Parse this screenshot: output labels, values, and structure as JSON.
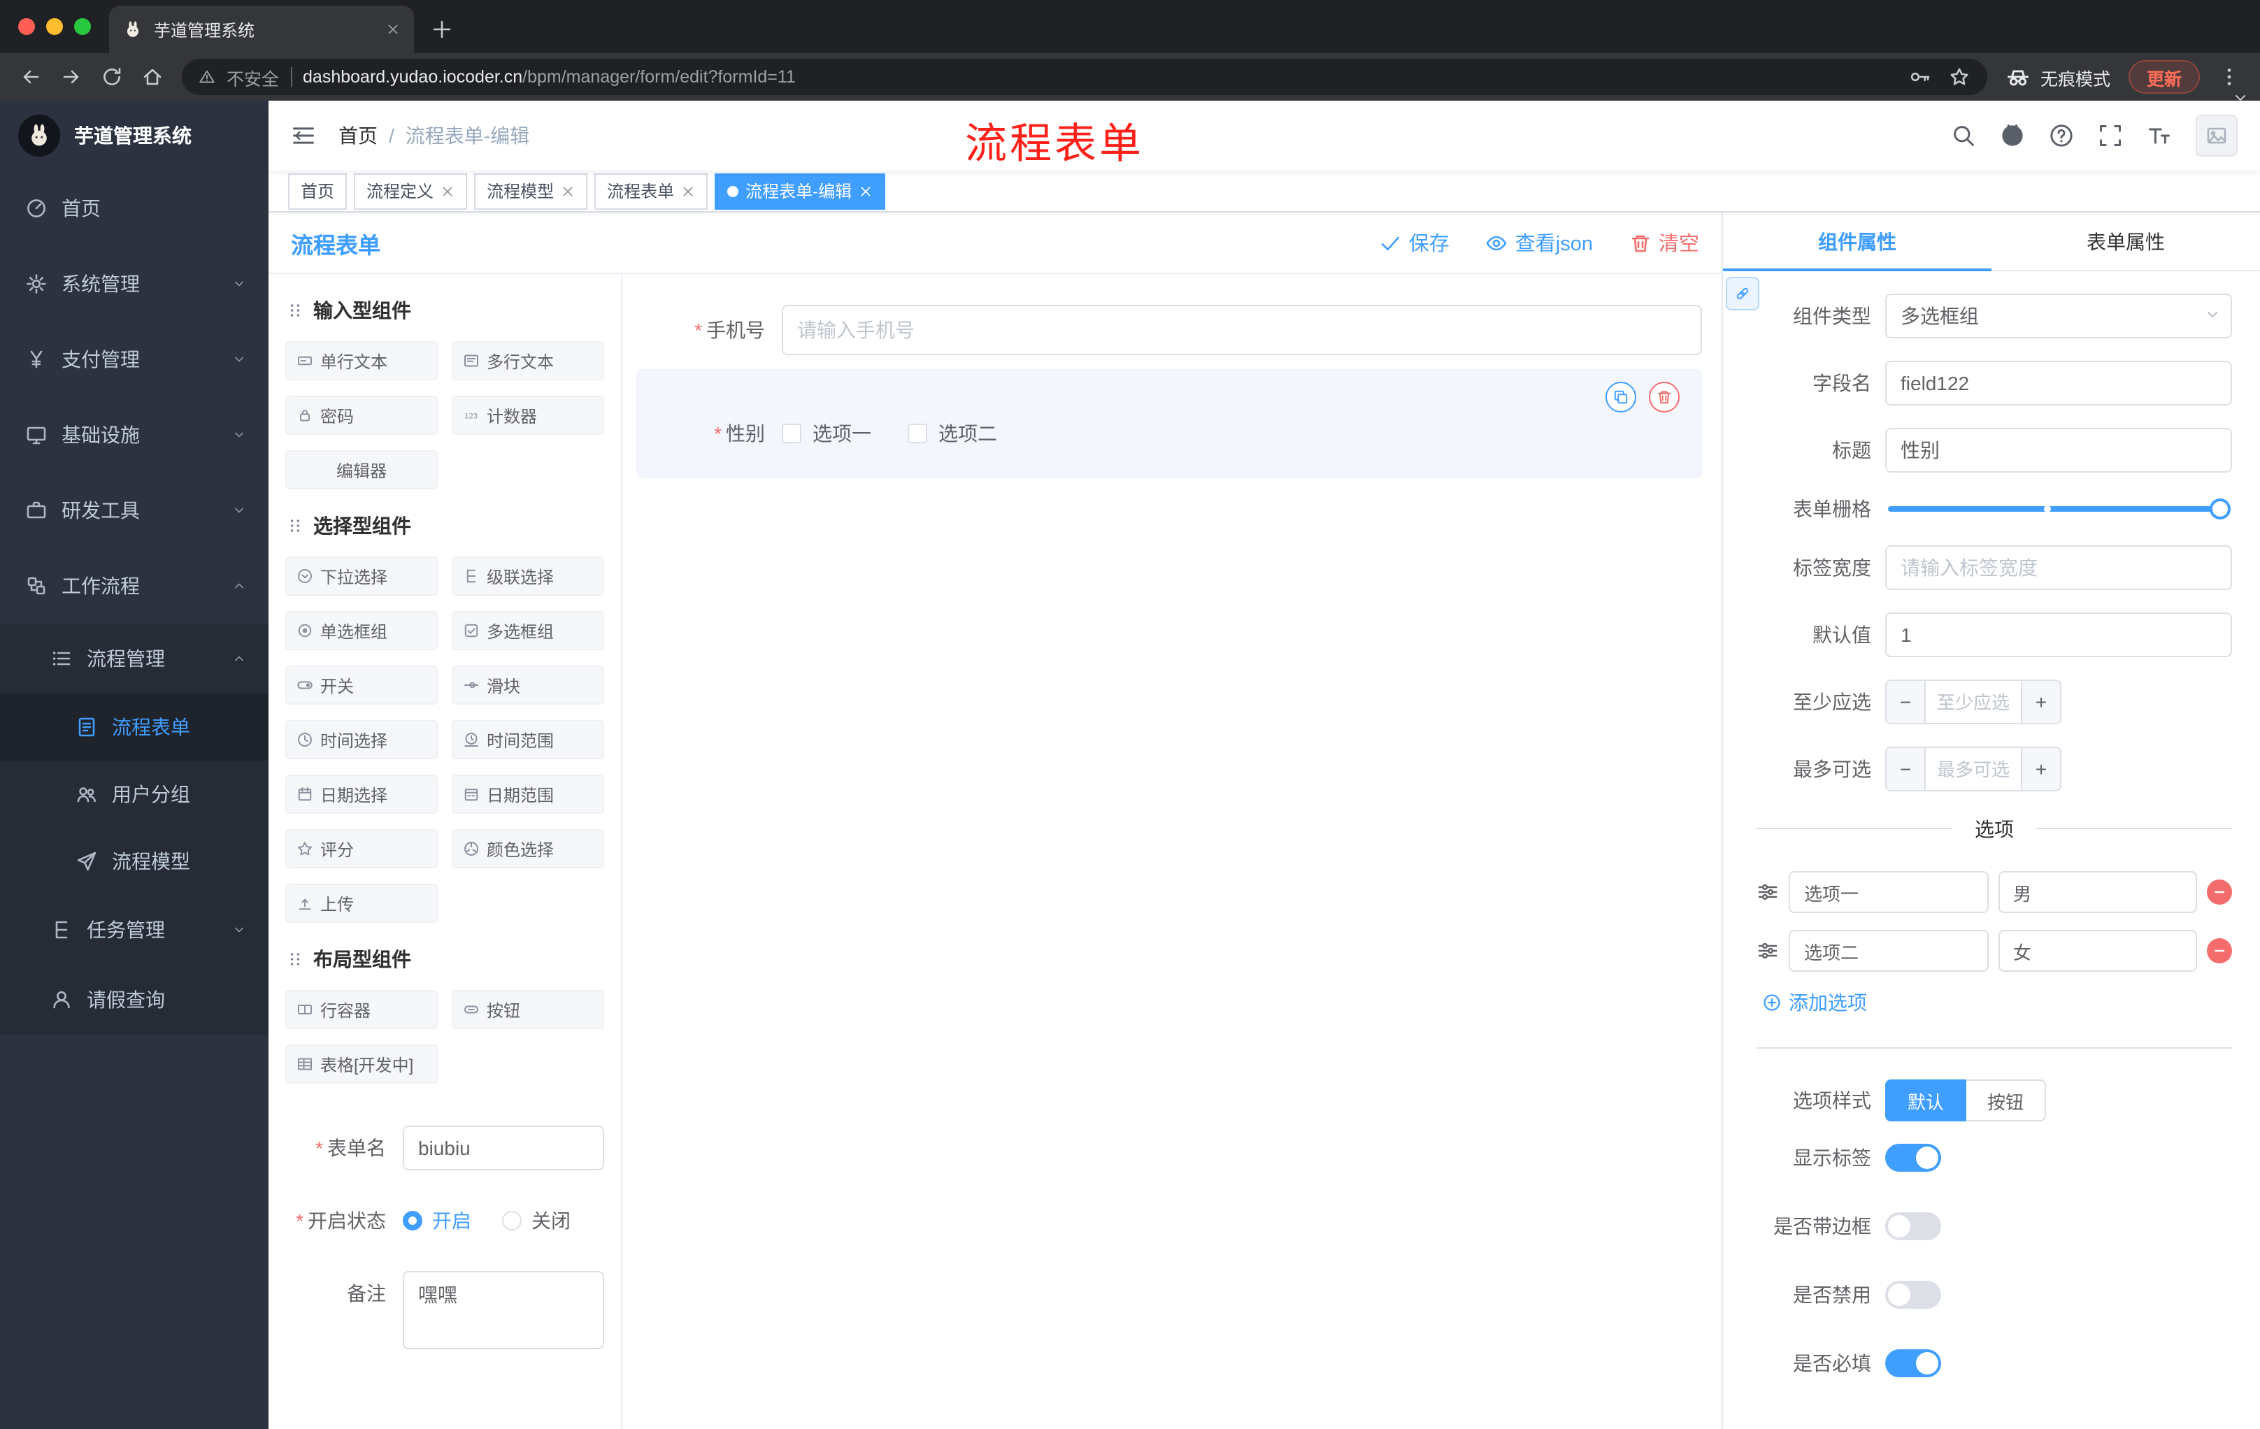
{
  "browser": {
    "tab_title": "芋道管理系统",
    "security_label": "不安全",
    "url_host": "dashboard.yudao.iocoder.cn",
    "url_path": "/bpm/manager/form/edit?formId=11",
    "incognito_label": "无痕模式",
    "update_label": "更新"
  },
  "sidebar": {
    "logo_title": "芋道管理系统",
    "home": "首页",
    "system": "系统管理",
    "payment": "支付管理",
    "infra": "基础设施",
    "devtools": "研发工具",
    "workflow": "工作流程",
    "process_mgmt": "流程管理",
    "process_form": "流程表单",
    "user_group": "用户分组",
    "process_model": "流程模型",
    "task_mgmt": "任务管理",
    "leave_query": "请假查询"
  },
  "header": {
    "breadcrumb_home": "首页",
    "breadcrumb_sep": "/",
    "breadcrumb_current": "流程表单-编辑",
    "annotation": "流程表单"
  },
  "tags": {
    "t0": "首页",
    "t1": "流程定义",
    "t2": "流程模型",
    "t3": "流程表单",
    "t4": "流程表单-编辑"
  },
  "designer": {
    "title": "流程表单",
    "save_label": "保存",
    "view_json_label": "查看json",
    "clear_label": "清空",
    "palette": {
      "group_input": "输入型组件",
      "group_select": "选择型组件",
      "group_layout": "布局型组件",
      "items": {
        "single_text": "单行文本",
        "multi_text": "多行文本",
        "password": "密码",
        "counter": "计数器",
        "editor": "编辑器",
        "select": "下拉选择",
        "cascader": "级联选择",
        "radio": "单选框组",
        "checkbox": "多选框组",
        "switch": "开关",
        "slider": "滑块",
        "time": "时间选择",
        "time_range": "时间范围",
        "date": "日期选择",
        "date_range": "日期范围",
        "rate": "评分",
        "color": "颜色选择",
        "upload": "上传",
        "row": "行容器",
        "button": "按钮",
        "table": "表格[开发中]"
      }
    },
    "meta": {
      "name_label": "表单名",
      "name_value": "biubiu",
      "status_label": "开启状态",
      "status_on": "开启",
      "status_off": "关闭",
      "remark_label": "备注",
      "remark_value": "嘿嘿"
    },
    "canvas": {
      "phone_label": "手机号",
      "phone_placeholder": "请输入手机号",
      "gender_label": "性别",
      "gender_opt1": "选项一",
      "gender_opt2": "选项二"
    },
    "props": {
      "tab_component": "组件属性",
      "tab_form": "表单属性",
      "type_label": "组件类型",
      "type_value": "多选框组",
      "field_label": "字段名",
      "field_value": "field122",
      "title_label": "标题",
      "title_value": "性别",
      "grid_label": "表单栅格",
      "label_width_label": "标签宽度",
      "label_width_placeholder": "请输入标签宽度",
      "default_label": "默认值",
      "default_value": "1",
      "min_label": "至少应选",
      "min_placeholder": "至少应选",
      "max_label": "最多可选",
      "max_placeholder": "最多可选",
      "stepper_minus": "−",
      "stepper_plus": "+",
      "options_title": "选项",
      "opt1_label": "选项一",
      "opt1_value": "男",
      "opt2_label": "选项二",
      "opt2_value": "女",
      "add_option": "添加选项",
      "style_label": "选项样式",
      "style_default": "默认",
      "style_button": "按钮",
      "show_label_label": "显示标签",
      "border_label": "是否带边框",
      "disabled_label": "是否禁用",
      "required_label": "是否必填"
    }
  }
}
